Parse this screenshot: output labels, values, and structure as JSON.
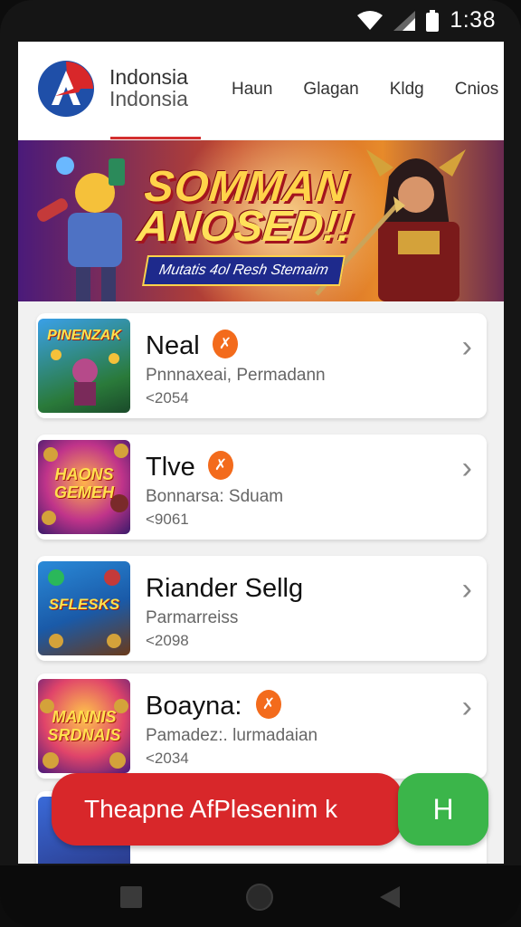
{
  "status_bar": {
    "time": "1:38"
  },
  "header": {
    "brand_line1": "Indonsia",
    "brand_line2": "Indonsia",
    "nav": [
      "Haun",
      "Glagan",
      "Kldg",
      "Cnios"
    ]
  },
  "banner": {
    "title_line1": "SOMMAN",
    "title_line2": "ANOSED!!",
    "subtitle": "Mutatis 4ol Resh Stemaim"
  },
  "games": [
    {
      "thumb_text": "PINENZAK",
      "title": "Neal",
      "badge": "✗",
      "subtitle": "Pnnnaxeai, Permadann",
      "meta": "<2054"
    },
    {
      "thumb_text": "HAONS GEMEH",
      "title": "Tlve",
      "badge": "✗",
      "subtitle": "Bonnarsa: Sduam",
      "meta": "<9061"
    },
    {
      "thumb_text": "SFLESKS",
      "title": "Riander Sellg",
      "badge": "",
      "subtitle": "Parmarreiss",
      "meta": "<2098"
    },
    {
      "thumb_text": "MANNIS SRDNAIS",
      "title": "Boayna:",
      "badge": "✗",
      "subtitle": "Pamadez:. lurmadaian",
      "meta": "<2034"
    }
  ],
  "cta": {
    "primary": "Theapne AfPlesenim k",
    "secondary": "H"
  },
  "colors": {
    "accent_red": "#d8272a",
    "accent_green": "#3bb54a",
    "badge_orange": "#f36b1c"
  }
}
